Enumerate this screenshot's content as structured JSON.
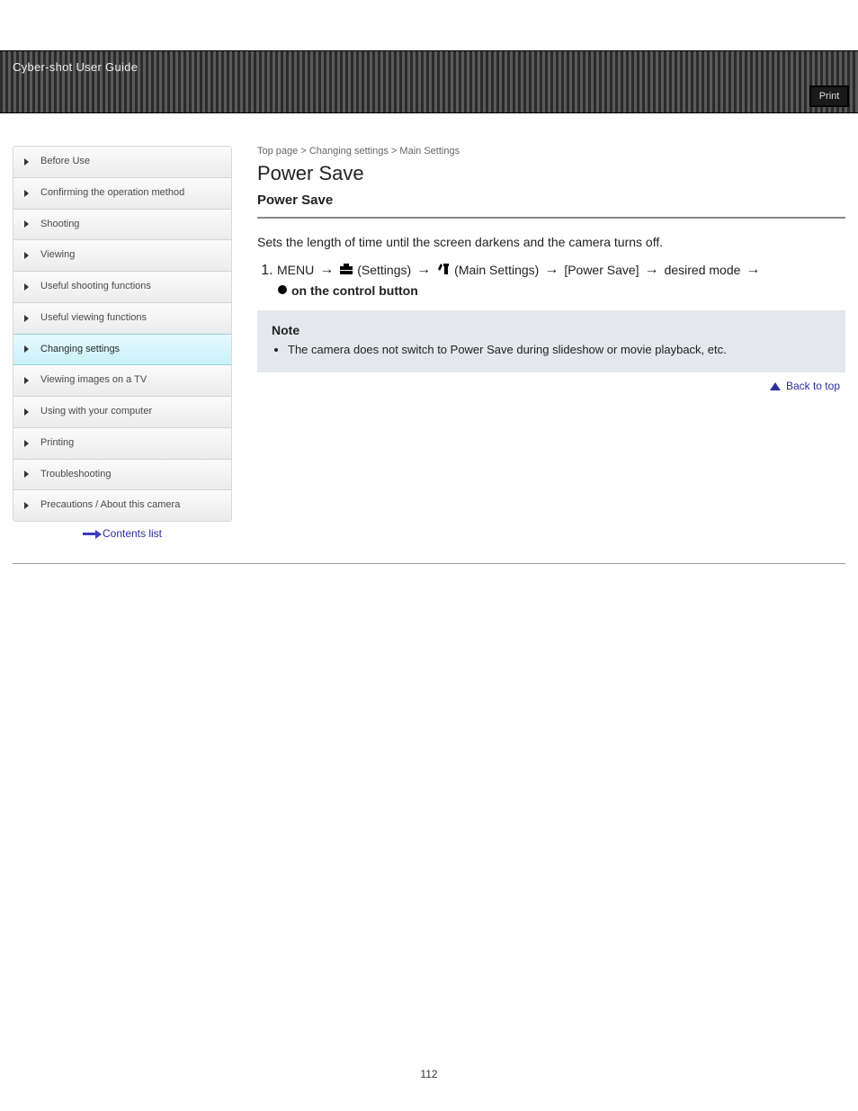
{
  "header": {
    "brand": "Cyber-shot User Guide",
    "print_link": "Print"
  },
  "sidebar": {
    "items": [
      "Before Use",
      "Confirming the operation method",
      "Shooting",
      "Viewing",
      "Useful shooting functions",
      "Useful viewing functions",
      "Changing settings",
      "Viewing images on a TV",
      "Using with your computer",
      "Printing",
      "Troubleshooting",
      "Precautions / About this camera"
    ],
    "active_index": 6,
    "back_label": "Contents list"
  },
  "main": {
    "top_link": "Top page",
    "breadcrumb": [
      "Changing settings",
      "Main Settings"
    ],
    "page_title": "Power Save",
    "section_title": "Power Save",
    "intro_text": "Sets the length of time until the screen darkens and the camera turns off.",
    "path": {
      "menu_label": "MENU",
      "step1": {
        "icon": "briefcase-icon",
        "label": "(Settings)"
      },
      "step2": {
        "icon": "tool-icon",
        "label": "(Main Settings)"
      },
      "step3": "[Power Save]",
      "step4": "desired mode",
      "step5": {
        "icon": "dot-icon",
        "label": "on the control button"
      }
    },
    "note_title": "Note",
    "note_item": "The camera does not switch to Power Save during slideshow or movie playback, etc.",
    "back_to_top": "Back to top",
    "page_number": "112"
  }
}
